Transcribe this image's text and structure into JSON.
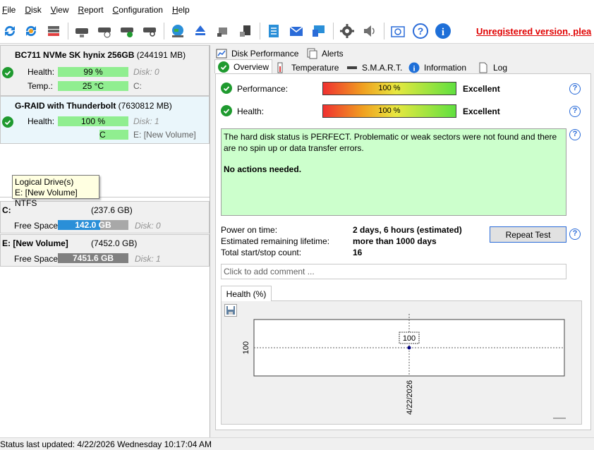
{
  "menu": [
    "File",
    "Disk",
    "View",
    "Report",
    "Configuration",
    "Help"
  ],
  "toolbar": {
    "icons": [
      "refresh-icon",
      "refresh-all-icon",
      "disk-list-icon",
      "disk-tool-icon",
      "disk-schedule-icon",
      "disk-check-icon",
      "disk-search-icon",
      "globe-icon",
      "eject-icon",
      "network-disk-icon",
      "usb-disk-icon",
      "notes-icon",
      "mail-icon",
      "remote-icon",
      "gear-icon",
      "speaker-icon",
      "screenshot-icon",
      "help-icon",
      "info-icon"
    ],
    "unregistered": "Unregistered version, plea"
  },
  "disks": [
    {
      "name": "BC711 NVMe SK hynix 256GB",
      "size": "(244191 MB)",
      "health_label": "Health:",
      "health_value": "99 %",
      "disk_label": "Disk: 0",
      "temp_label": "Temp.:",
      "temp_value": "25 °C",
      "drive_letter": "C:"
    },
    {
      "name": "G-RAID  with Thunderbolt",
      "size": "(7630812 MB)",
      "health_label": "Health:",
      "health_value": "100 %",
      "disk_label": "Disk: 1",
      "temp_value_partial": "C",
      "drive_letter": "E:",
      "volume_note": "[New Volume]"
    }
  ],
  "tooltip": {
    "line1": "Logical Drive(s)",
    "line2": "E: [New Volume] NTFS"
  },
  "volumes": [
    {
      "name": "C:",
      "size": "(237.6 GB)",
      "free_label": "Free Space",
      "free_value": "142.0 GB",
      "free_fraction": 0.6,
      "color": "#2a8fd8",
      "disk": "Disk: 0"
    },
    {
      "name": "E: [New Volume]",
      "size": "(7452.0 GB)",
      "free_label": "Free Space",
      "free_value": "7451.6 GB",
      "free_fraction": 1.0,
      "color": "#808080",
      "disk": "Disk: 1"
    }
  ],
  "tabs": {
    "row1": [
      "Disk Performance",
      "Alerts"
    ],
    "row2": [
      "Overview",
      "Temperature",
      "S.M.A.R.T.",
      "Information",
      "Log"
    ],
    "active": "Overview"
  },
  "overview": {
    "performance_label": "Performance:",
    "performance_value": "100 %",
    "performance_rating": "Excellent",
    "health_label": "Health:",
    "health_value": "100 %",
    "health_rating": "Excellent",
    "status_line1": "The hard disk status is PERFECT. Problematic or weak sectors were not found and there are no spin up or data transfer errors.",
    "status_line2": "No actions needed.",
    "power_on_label": "Power on time:",
    "power_on_value": "2 days, 6 hours (estimated)",
    "lifetime_label": "Estimated remaining lifetime:",
    "lifetime_value": "more than 1000 days",
    "startstop_label": "Total start/stop count:",
    "startstop_value": "16",
    "repeat_button": "Repeat Test",
    "comment_placeholder": "Click to add comment ..."
  },
  "chart_data": {
    "type": "scatter",
    "tab_label": "Health (%)",
    "x": [
      "4/22/2026"
    ],
    "values": [
      100
    ],
    "ylabel_tick": "100",
    "point_label": "100",
    "grid": true
  },
  "status_bar": "Status last updated: 4/22/2026 Wednesday 10:17:04 AM"
}
